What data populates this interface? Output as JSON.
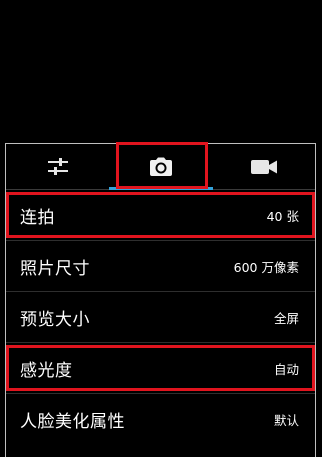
{
  "tabs": [
    {
      "icon": "sliders-icon"
    },
    {
      "icon": "camera-icon",
      "selected": true
    },
    {
      "icon": "video-camera-icon"
    }
  ],
  "settings": [
    {
      "label": "连拍",
      "value": "40 张",
      "highlighted": true
    },
    {
      "label": "照片尺寸",
      "value": "600 万像素",
      "highlighted": false
    },
    {
      "label": "预览大小",
      "value": "全屏",
      "highlighted": false
    },
    {
      "label": "感光度",
      "value": "自动",
      "highlighted": true
    },
    {
      "label": "人脸美化属性",
      "value": "默认",
      "highlighted": false
    }
  ],
  "colors": {
    "accent": "#33a3dc",
    "highlight": "#e0141e",
    "background": "#000000",
    "text": "#ffffff"
  }
}
